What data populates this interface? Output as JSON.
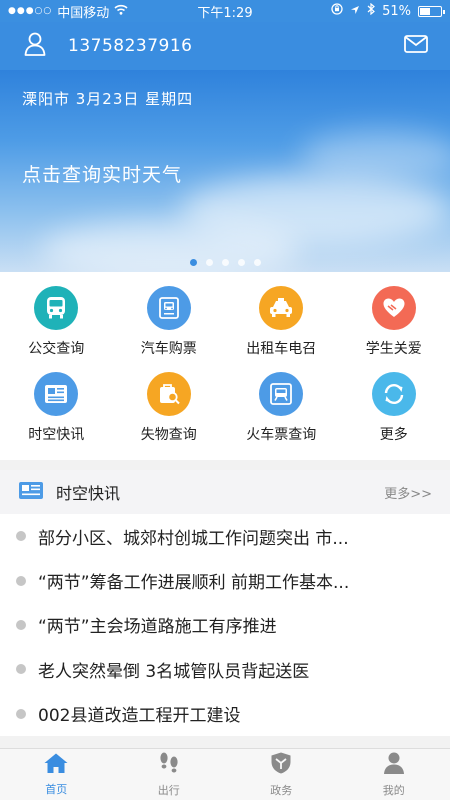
{
  "status_bar": {
    "carrier": "中国移动",
    "time": "下午1:29",
    "battery": "51%",
    "battery_level": 0.51
  },
  "top_bar": {
    "phone": "13758237916"
  },
  "banner": {
    "date": "溧阳市 3月23日 星期四",
    "headline": "点击查询实时天气",
    "pages": 5,
    "active_page": 0
  },
  "services": [
    {
      "label": "公交查询",
      "icon": "bus-icon",
      "color": "#1fb2b8"
    },
    {
      "label": "汽车购票",
      "icon": "bus-ticket-icon",
      "color": "#4d9be6"
    },
    {
      "label": "出租车电召",
      "icon": "taxi-icon",
      "color": "#f6a623"
    },
    {
      "label": "学生关爱",
      "icon": "heart-hands-icon",
      "color": "#f36a55"
    },
    {
      "label": "时空快讯",
      "icon": "news-icon",
      "color": "#4d9be6"
    },
    {
      "label": "失物查询",
      "icon": "lost-found-icon",
      "color": "#f6a623"
    },
    {
      "label": "火车票查询",
      "icon": "train-icon",
      "color": "#4d9be6"
    },
    {
      "label": "更多",
      "icon": "refresh-icon",
      "color": "#4ab8ea"
    }
  ],
  "news": {
    "title": "时空快讯",
    "more": "更多>>",
    "items": [
      "部分小区、城郊村创城工作问题突出 市...",
      "“两节”筹备工作进展顺利 前期工作基本...",
      "“两节”主会场道路施工有序推进",
      "老人突然晕倒 3名城管队员背起送医",
      "002县道改造工程开工建设"
    ]
  },
  "tabs": [
    {
      "label": "首页",
      "icon": "home-icon",
      "active": true
    },
    {
      "label": "出行",
      "icon": "footprints-icon",
      "active": false
    },
    {
      "label": "政务",
      "icon": "shield-icon",
      "active": false
    },
    {
      "label": "我的",
      "icon": "user-icon",
      "active": false
    }
  ],
  "colors": {
    "primary": "#3a8de0",
    "inactive": "#8a8a8a"
  }
}
